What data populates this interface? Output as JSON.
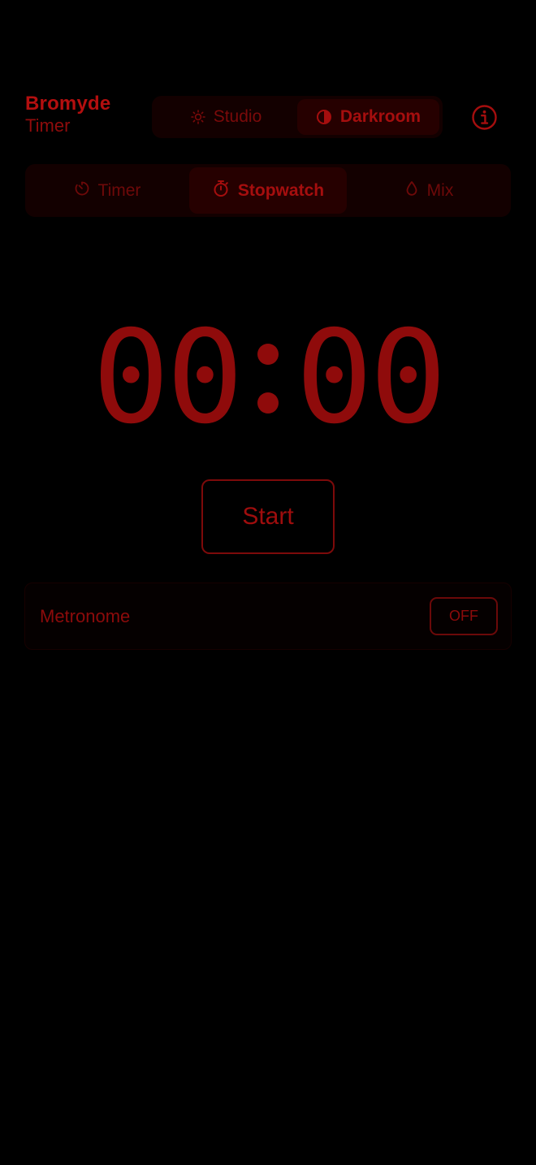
{
  "header": {
    "brand_name": "Bromyde",
    "brand_sub": "Timer",
    "modes": [
      {
        "label": "Studio",
        "icon": "sun-icon",
        "active": false
      },
      {
        "label": "Darkroom",
        "icon": "contrast-icon",
        "active": true
      }
    ],
    "info_icon": "info-icon"
  },
  "tabs": [
    {
      "label": "Timer",
      "icon": "timer-icon",
      "active": false
    },
    {
      "label": "Stopwatch",
      "icon": "stopwatch-icon",
      "active": true
    },
    {
      "label": "Mix",
      "icon": "drop-icon",
      "active": false
    }
  ],
  "display": {
    "minutes": "00",
    "seconds": "00"
  },
  "controls": {
    "start_label": "Start"
  },
  "metronome": {
    "label": "Metronome",
    "state": "OFF"
  },
  "colors": {
    "background": "#000000",
    "accent": "#a00d0d",
    "panel": "#130000",
    "active_panel": "#260000"
  }
}
